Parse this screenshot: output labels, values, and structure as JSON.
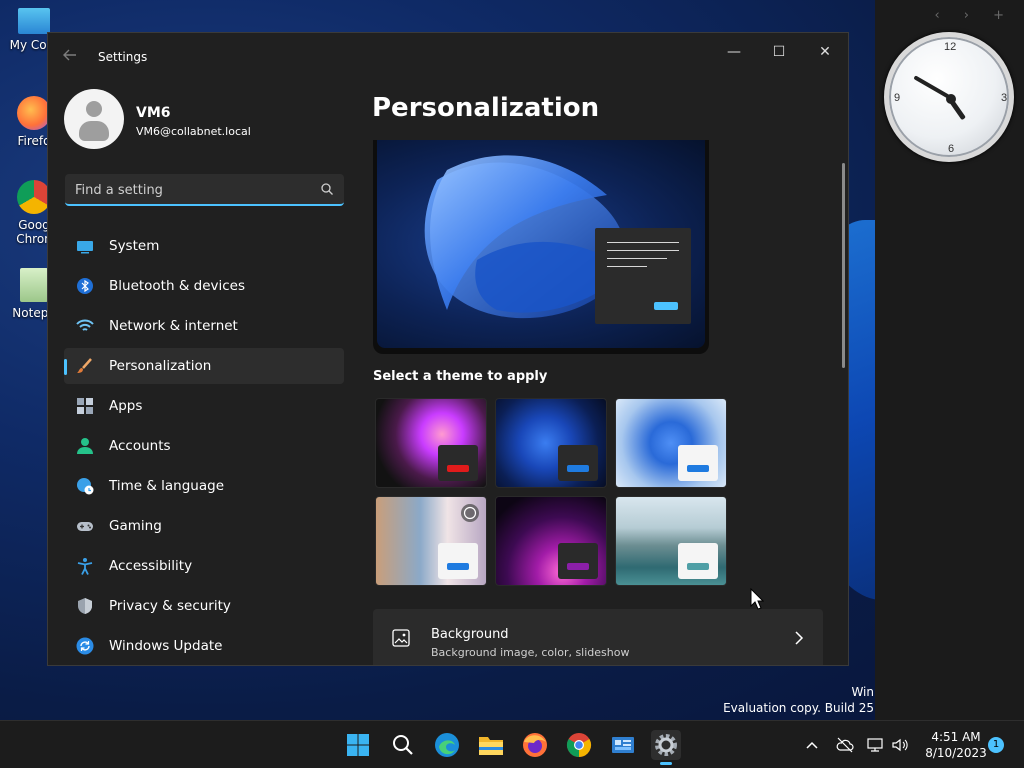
{
  "desktop": {
    "icons": [
      {
        "label": "My Com"
      },
      {
        "label": "Firefo"
      },
      {
        "label": "Goog",
        "label2": "Chron"
      },
      {
        "label": "Notepa"
      }
    ],
    "eval_line1": "Win",
    "eval_line2": "Evaluation copy. Build 25",
    "clock": {
      "n12": "12",
      "n3": "3",
      "n6": "6",
      "n9": "9"
    },
    "panel_nav": "‹ › +"
  },
  "window": {
    "title": "Settings",
    "controls": {
      "minimize": "—",
      "maximize": "☐",
      "close": "✕"
    }
  },
  "profile": {
    "name": "VM6",
    "email": "VM6@collabnet.local"
  },
  "search": {
    "placeholder": "Find a setting"
  },
  "nav": {
    "items": [
      {
        "label": "System"
      },
      {
        "label": "Bluetooth & devices"
      },
      {
        "label": "Network & internet"
      },
      {
        "label": "Personalization"
      },
      {
        "label": "Apps"
      },
      {
        "label": "Accounts"
      },
      {
        "label": "Time & language"
      },
      {
        "label": "Gaming"
      },
      {
        "label": "Accessibility"
      },
      {
        "label": "Privacy & security"
      },
      {
        "label": "Windows Update"
      }
    ]
  },
  "main": {
    "title": "Personalization",
    "themes_label": "Select a theme to apply",
    "background": {
      "title": "Background",
      "subtitle": "Background image, color, slideshow"
    }
  },
  "taskbar": {
    "time": "4:51 AM",
    "date": "8/10/2023",
    "notification_count": "1"
  },
  "colors": {
    "accent": "#4cc2ff",
    "window_bg": "#202020",
    "taskbar_bg": "#1c1c1c"
  }
}
